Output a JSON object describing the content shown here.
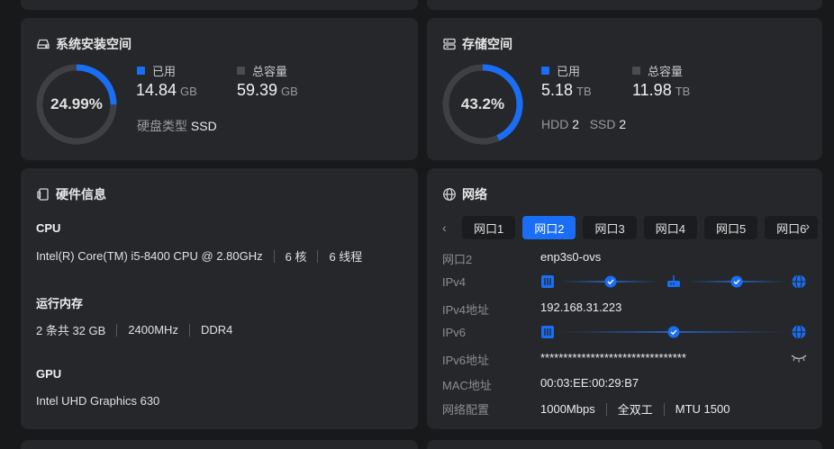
{
  "system": {
    "title": "系统安装空间",
    "percent_label": "24.99%",
    "percent": 24.99,
    "used_label": "已用",
    "used_value": "14.84",
    "used_unit": "GB",
    "total_label": "总容量",
    "total_value": "59.39",
    "total_unit": "GB",
    "disk_type_label": "硬盘类型",
    "disk_type_value": "SSD"
  },
  "storage": {
    "title": "存储空间",
    "percent_label": "43.2%",
    "percent": 43.2,
    "used_label": "已用",
    "used_value": "5.18",
    "used_unit": "TB",
    "total_label": "总容量",
    "total_value": "11.98",
    "total_unit": "TB",
    "hdd_label": "HDD",
    "hdd_value": "2",
    "ssd_label": "SSD",
    "ssd_value": "2"
  },
  "hardware": {
    "title": "硬件信息",
    "cpu_heading": "CPU",
    "cpu_model": "Intel(R) Core(TM) i5-8400 CPU @ 2.80GHz",
    "cpu_cores": "6 核",
    "cpu_threads": "6 线程",
    "mem_heading": "运行内存",
    "mem_size": "2 条共 32 GB",
    "mem_speed": "2400MHz",
    "mem_type": "DDR4",
    "gpu_heading": "GPU",
    "gpu_model": "Intel UHD Graphics 630"
  },
  "network": {
    "title": "网络",
    "tabs": [
      "网口1",
      "网口2",
      "网口3",
      "网口4",
      "网口5",
      "网口6"
    ],
    "active_tab": 1,
    "port_label": "网口2",
    "port_value": "enp3s0-ovs",
    "ipv4_label": "IPv4",
    "ipv4_addr_label": "IPv4地址",
    "ipv4_addr_value": "192.168.31.223",
    "ipv6_label": "IPv6",
    "ipv6_addr_label": "IPv6地址",
    "ipv6_addr_value": "********************************",
    "mac_label": "MAC地址",
    "mac_value": "00:03:EE:00:29:B7",
    "config_label": "网络配置",
    "speed_value": "1000Mbps",
    "duplex_value": "全双工",
    "mtu_value": "MTU 1500"
  },
  "colors": {
    "accent": "#1a6ef5",
    "card_bg": "#25272b",
    "page_bg": "#18191b",
    "ring_track": "#3e4045"
  }
}
